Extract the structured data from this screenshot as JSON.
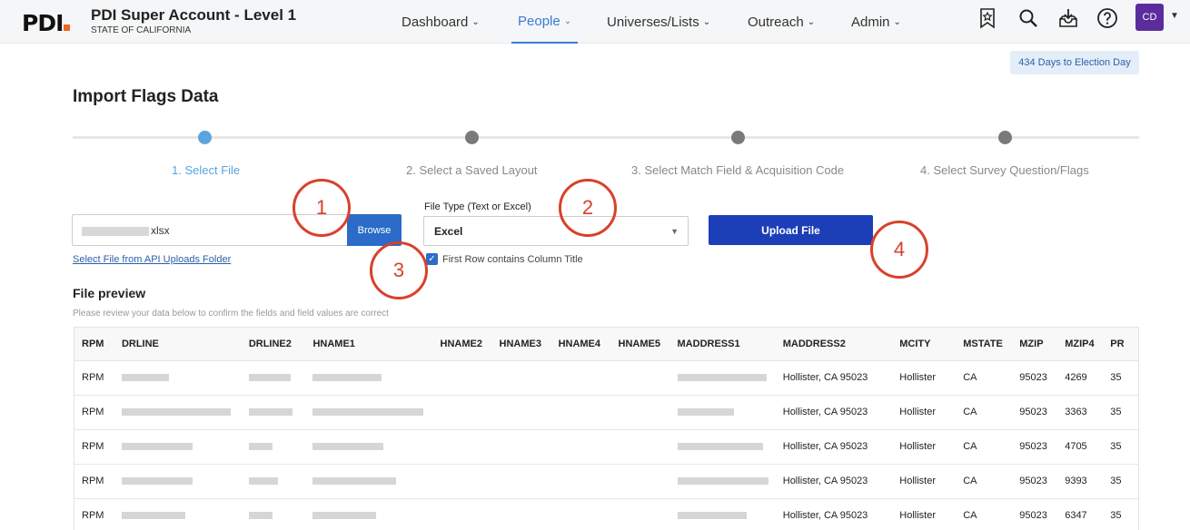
{
  "header": {
    "logo": "PDI",
    "account_title": "PDI Super Account - Level 1",
    "account_subtitle": "STATE OF CALIFORNIA",
    "nav": [
      {
        "label": "Dashboard",
        "active": false
      },
      {
        "label": "People",
        "active": true
      },
      {
        "label": "Universes/Lists",
        "active": false
      },
      {
        "label": "Outreach",
        "active": false
      },
      {
        "label": "Admin",
        "active": false
      }
    ],
    "icons": [
      "bookmark-star-icon",
      "search-icon",
      "download-tray-icon",
      "help-icon"
    ],
    "avatar_initials": "CD",
    "accent": "#3a7bd5"
  },
  "election_badge": "434 Days to Election Day",
  "page_title": "Import Flags Data",
  "steps": [
    {
      "label": "1. Select File",
      "active": true
    },
    {
      "label": "2. Select a Saved Layout",
      "active": false
    },
    {
      "label": "3. Select Match Field & Acquisition Code",
      "active": false
    },
    {
      "label": "4. Select Survey Question/Flags",
      "active": false
    }
  ],
  "file": {
    "value": "xlsx",
    "browse_label": "Browse",
    "api_link": "Select File from API Uploads Folder"
  },
  "file_type": {
    "label": "File Type (Text or Excel)",
    "value": "Excel",
    "first_row_label": "First Row contains Column Title",
    "first_row_checked": true
  },
  "upload_label": "Upload File",
  "callouts": [
    "1",
    "2",
    "3",
    "4"
  ],
  "preview": {
    "title": "File preview",
    "subtitle": "Please review your data below to confirm the fields and field values are correct",
    "columns": [
      "RPM",
      "DRLINE",
      "DRLINE2",
      "HNAME1",
      "HNAME2",
      "HNAME3",
      "HNAME4",
      "HNAME5",
      "MADDRESS1",
      "MADDRESS2",
      "MCITY",
      "MSTATE",
      "MZIP",
      "MZIP4",
      "PR"
    ],
    "rows": [
      [
        "RPM",
        "",
        "",
        "",
        "",
        "",
        "",
        "",
        "",
        "Hollister, CA  95023",
        "Hollister",
        "CA",
        "95023",
        "4269",
        "35"
      ],
      [
        "RPM",
        "",
        "",
        "",
        "",
        "",
        "",
        "",
        "",
        "Hollister, CA  95023",
        "Hollister",
        "CA",
        "95023",
        "3363",
        "35"
      ],
      [
        "RPM",
        "",
        "",
        "",
        "",
        "",
        "",
        "",
        "",
        "Hollister, CA  95023",
        "Hollister",
        "CA",
        "95023",
        "4705",
        "35"
      ],
      [
        "RPM",
        "",
        "",
        "",
        "",
        "",
        "",
        "",
        "",
        "Hollister, CA  95023",
        "Hollister",
        "CA",
        "95023",
        "9393",
        "35"
      ],
      [
        "RPM",
        "",
        "",
        "",
        "",
        "",
        "",
        "",
        "",
        "Hollister, CA  95023",
        "Hollister",
        "CA",
        "95023",
        "6347",
        "35"
      ]
    ]
  }
}
